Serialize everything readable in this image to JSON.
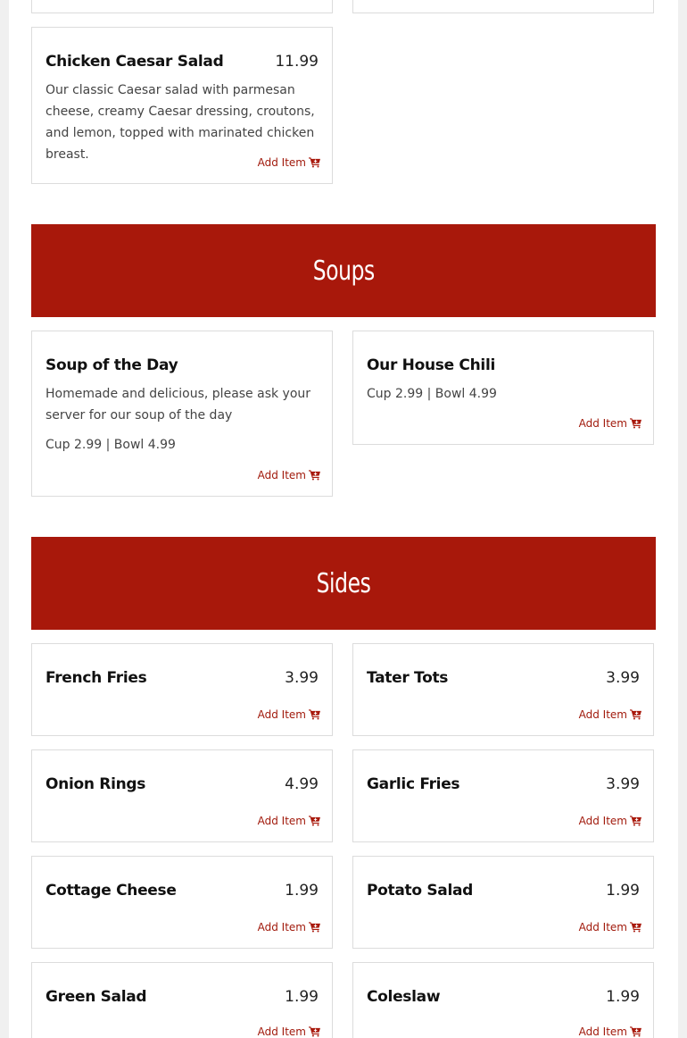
{
  "add_label": "Add Item",
  "accent_color": "#a8180b",
  "top_card": {
    "name": "Chicken Caesar Salad",
    "price": "11.99",
    "desc": "Our classic Caesar salad with parmesan cheese, creamy Caesar dressing, croutons, and lemon, topped with marinated chicken breast."
  },
  "soups": {
    "title": "Soups",
    "items": [
      {
        "name": "Soup of the Day",
        "desc": "Homemade and delicious, please ask your server for our soup of the day",
        "price_line": "Cup 2.99 | Bowl 4.99"
      },
      {
        "name": "Our House Chili",
        "price_line": "Cup 2.99 | Bowl 4.99"
      }
    ]
  },
  "sides": {
    "title": "Sides",
    "items": [
      {
        "name": "French Fries",
        "price": "3.99"
      },
      {
        "name": "Tater Tots",
        "price": "3.99"
      },
      {
        "name": "Onion Rings",
        "price": "4.99"
      },
      {
        "name": "Garlic Fries",
        "price": "3.99"
      },
      {
        "name": "Cottage Cheese",
        "price": "1.99"
      },
      {
        "name": "Potato Salad",
        "price": "1.99"
      },
      {
        "name": "Green Salad",
        "price": "1.99"
      },
      {
        "name": "Coleslaw",
        "price": "1.99"
      }
    ]
  }
}
